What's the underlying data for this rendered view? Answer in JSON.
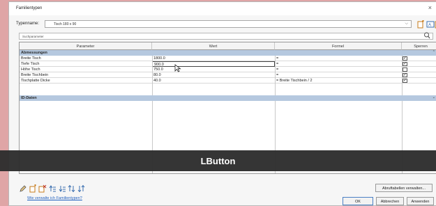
{
  "window": {
    "title": "Familientypen",
    "close": "×"
  },
  "type_selector": {
    "label": "Typenname:",
    "value": "Tisch 180 x 90",
    "chevron": "⌵"
  },
  "toolbar_icons": [
    "new-type-icon",
    "rename-type-icon",
    "delete-type-icon"
  ],
  "search": {
    "placeholder": "Suchparameter",
    "icon": "search-icon"
  },
  "grid": {
    "columns": [
      "Parameter",
      "Wert",
      "Formel",
      "Sperren"
    ],
    "groups": [
      {
        "label": "Abmessungen",
        "arrow": "⌃",
        "rows": [
          {
            "parameter": "Breite Tisch",
            "wert": "1800.0",
            "formel": "=",
            "sperren": true
          },
          {
            "parameter": "Tiefe Tisch",
            "wert": "900.0",
            "formel": "=",
            "sperren": true
          },
          {
            "parameter": "Höhe Tisch",
            "wert": "750.0",
            "formel": "=",
            "sperren": false
          },
          {
            "parameter": "Breite Tischbein",
            "wert": "80.0",
            "formel": "=",
            "sperren": true
          },
          {
            "parameter": "Tischplatte Dicke",
            "wert": "40.0",
            "formel": "= Breite Tischbein / 2",
            "sperren": true
          }
        ]
      },
      {
        "label": "ID-Daten",
        "arrow": "⌄",
        "rows": []
      }
    ]
  },
  "overlay": {
    "text": "LButton"
  },
  "bottom_icons": [
    "edit-param-icon",
    "new-param-icon",
    "delete-param-icon",
    "move-up-icon",
    "move-down-icon",
    "sort-asc-icon",
    "sort-desc-icon"
  ],
  "help_link": "Wie verwalte ich Familientypen?",
  "buttons": {
    "lookup_tables": "Abruftabellen verwalten...",
    "ok": "OK",
    "cancel": "Abbrechen",
    "apply": "Anwenden"
  },
  "colors": {
    "group_header": "#b5c8df",
    "background": "#dfa5a6",
    "link": "#1f5fbf"
  }
}
